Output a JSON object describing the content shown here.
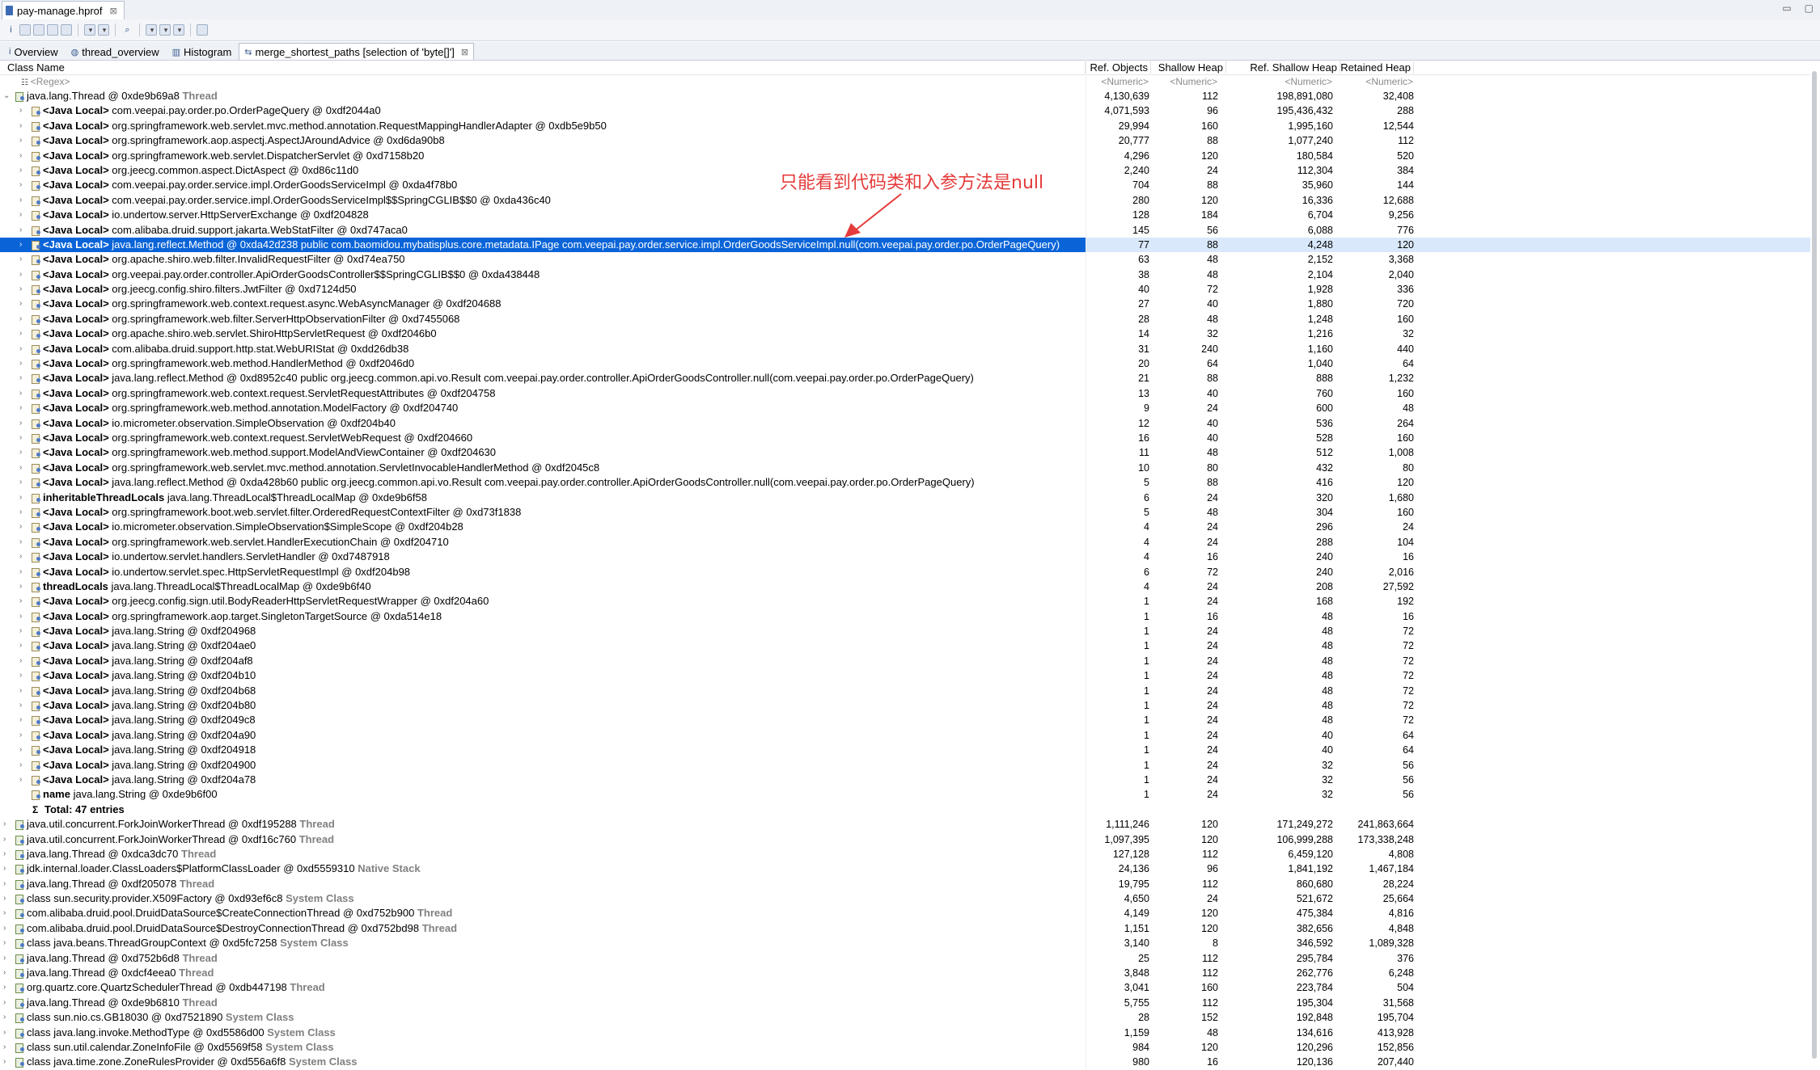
{
  "editor_tab": {
    "label": "pay-manage.hprof",
    "close": "⊠"
  },
  "view_tabs": [
    {
      "icon": "i",
      "label": "Overview"
    },
    {
      "icon": "◍",
      "label": "thread_overview"
    },
    {
      "icon": "▥",
      "label": "Histogram"
    },
    {
      "icon": "⇆",
      "label": "merge_shortest_paths [selection of 'byte[]']",
      "close": "⊠",
      "active": true
    }
  ],
  "columns": {
    "name": "Class Name",
    "ref_objects": "Ref. Objects",
    "shallow_heap": "Shallow Heap",
    "ref_shallow_heap": "Ref. Shallow Heap",
    "retained_heap": "Retained Heap"
  },
  "filters": {
    "name": "<Regex>",
    "numeric": "<Numeric>"
  },
  "annotation": "只能看到代码类和入参方法是null",
  "rows": [
    {
      "d": 0,
      "exp": "v",
      "icon": "thr",
      "t": "java.lang.Thread @ 0xde9b69a8",
      "tag": "Thread",
      "v": [
        "4,130,639",
        "112",
        "198,891,080",
        "32,408"
      ]
    },
    {
      "d": 1,
      "icon": "obj",
      "b": "<Java Local>",
      "t": "com.veepai.pay.order.po.OrderPageQuery @ 0xdf2044a0",
      "v": [
        "4,071,593",
        "96",
        "195,436,432",
        "288"
      ]
    },
    {
      "d": 1,
      "icon": "obj",
      "b": "<Java Local>",
      "t": "org.springframework.web.servlet.mvc.method.annotation.RequestMappingHandlerAdapter @ 0xdb5e9b50",
      "v": [
        "29,994",
        "160",
        "1,995,160",
        "12,544"
      ]
    },
    {
      "d": 1,
      "icon": "obj",
      "b": "<Java Local>",
      "t": "org.springframework.aop.aspectj.AspectJAroundAdvice @ 0xd6da90b8",
      "v": [
        "20,777",
        "88",
        "1,077,240",
        "112"
      ]
    },
    {
      "d": 1,
      "icon": "obj",
      "b": "<Java Local>",
      "t": "org.springframework.web.servlet.DispatcherServlet @ 0xd7158b20",
      "v": [
        "4,296",
        "120",
        "180,584",
        "520"
      ]
    },
    {
      "d": 1,
      "icon": "obj",
      "b": "<Java Local>",
      "t": "org.jeecg.common.aspect.DictAspect @ 0xd86c11d0",
      "v": [
        "2,240",
        "24",
        "112,304",
        "384"
      ]
    },
    {
      "d": 1,
      "icon": "obj",
      "b": "<Java Local>",
      "t": "com.veepai.pay.order.service.impl.OrderGoodsServiceImpl @ 0xda4f78b0",
      "v": [
        "704",
        "88",
        "35,960",
        "144"
      ]
    },
    {
      "d": 1,
      "icon": "obj",
      "b": "<Java Local>",
      "t": "com.veepai.pay.order.service.impl.OrderGoodsServiceImpl$$SpringCGLIB$$0 @ 0xda436c40",
      "v": [
        "280",
        "120",
        "16,336",
        "12,688"
      ]
    },
    {
      "d": 1,
      "icon": "obj",
      "b": "<Java Local>",
      "t": "io.undertow.server.HttpServerExchange @ 0xdf204828",
      "v": [
        "128",
        "184",
        "6,704",
        "9,256"
      ]
    },
    {
      "d": 1,
      "icon": "obj",
      "b": "<Java Local>",
      "t": "com.alibaba.druid.support.jakarta.WebStatFilter @ 0xd747aca0",
      "v": [
        "145",
        "56",
        "6,088",
        "776"
      ]
    },
    {
      "d": 1,
      "icon": "obj",
      "b": "<Java Local>",
      "t": "java.lang.reflect.Method @ 0xda42d238  public com.baomidou.mybatisplus.core.metadata.IPage com.veepai.pay.order.service.impl.OrderGoodsServiceImpl.null(com.veepai.pay.order.po.OrderPageQuery)",
      "v": [
        "77",
        "88",
        "4,248",
        "120"
      ],
      "sel": true
    },
    {
      "d": 1,
      "icon": "obj",
      "b": "<Java Local>",
      "t": "org.apache.shiro.web.filter.InvalidRequestFilter @ 0xd74ea750",
      "v": [
        "63",
        "48",
        "2,152",
        "3,368"
      ]
    },
    {
      "d": 1,
      "icon": "obj",
      "b": "<Java Local>",
      "t": "org.veepai.pay.order.controller.ApiOrderGoodsController$$SpringCGLIB$$0 @ 0xda438448",
      "v": [
        "38",
        "48",
        "2,104",
        "2,040"
      ]
    },
    {
      "d": 1,
      "icon": "obj",
      "b": "<Java Local>",
      "t": "org.jeecg.config.shiro.filters.JwtFilter @ 0xd7124d50",
      "v": [
        "40",
        "72",
        "1,928",
        "336"
      ]
    },
    {
      "d": 1,
      "icon": "obj",
      "b": "<Java Local>",
      "t": "org.springframework.web.context.request.async.WebAsyncManager @ 0xdf204688",
      "v": [
        "27",
        "40",
        "1,880",
        "720"
      ]
    },
    {
      "d": 1,
      "icon": "obj",
      "b": "<Java Local>",
      "t": "org.springframework.web.filter.ServerHttpObservationFilter @ 0xd7455068",
      "v": [
        "28",
        "48",
        "1,248",
        "160"
      ]
    },
    {
      "d": 1,
      "icon": "obj",
      "b": "<Java Local>",
      "t": "org.apache.shiro.web.servlet.ShiroHttpServletRequest @ 0xdf2046b0",
      "v": [
        "14",
        "32",
        "1,216",
        "32"
      ]
    },
    {
      "d": 1,
      "icon": "obj",
      "b": "<Java Local>",
      "t": "com.alibaba.druid.support.http.stat.WebURIStat @ 0xdd26db38",
      "v": [
        "31",
        "240",
        "1,160",
        "440"
      ]
    },
    {
      "d": 1,
      "icon": "obj",
      "b": "<Java Local>",
      "t": "org.springframework.web.method.HandlerMethod @ 0xdf2046d0",
      "v": [
        "20",
        "64",
        "1,040",
        "64"
      ]
    },
    {
      "d": 1,
      "icon": "obj",
      "b": "<Java Local>",
      "t": "java.lang.reflect.Method @ 0xd8952c40  public org.jeecg.common.api.vo.Result com.veepai.pay.order.controller.ApiOrderGoodsController.null(com.veepai.pay.order.po.OrderPageQuery)",
      "v": [
        "21",
        "88",
        "888",
        "1,232"
      ]
    },
    {
      "d": 1,
      "icon": "obj",
      "b": "<Java Local>",
      "t": "org.springframework.web.context.request.ServletRequestAttributes @ 0xdf204758",
      "v": [
        "13",
        "40",
        "760",
        "160"
      ]
    },
    {
      "d": 1,
      "icon": "obj",
      "b": "<Java Local>",
      "t": "org.springframework.web.method.annotation.ModelFactory @ 0xdf204740",
      "v": [
        "9",
        "24",
        "600",
        "48"
      ]
    },
    {
      "d": 1,
      "icon": "obj",
      "b": "<Java Local>",
      "t": "io.micrometer.observation.SimpleObservation @ 0xdf204b40",
      "v": [
        "12",
        "40",
        "536",
        "264"
      ]
    },
    {
      "d": 1,
      "icon": "obj",
      "b": "<Java Local>",
      "t": "org.springframework.web.context.request.ServletWebRequest @ 0xdf204660",
      "v": [
        "16",
        "40",
        "528",
        "160"
      ]
    },
    {
      "d": 1,
      "icon": "obj",
      "b": "<Java Local>",
      "t": "org.springframework.web.method.support.ModelAndViewContainer @ 0xdf204630",
      "v": [
        "11",
        "48",
        "512",
        "1,008"
      ]
    },
    {
      "d": 1,
      "icon": "obj",
      "b": "<Java Local>",
      "t": "org.springframework.web.servlet.mvc.method.annotation.ServletInvocableHandlerMethod @ 0xdf2045c8",
      "v": [
        "10",
        "80",
        "432",
        "80"
      ]
    },
    {
      "d": 1,
      "icon": "obj",
      "b": "<Java Local>",
      "t": "java.lang.reflect.Method @ 0xda428b60  public org.jeecg.common.api.vo.Result com.veepai.pay.order.controller.ApiOrderGoodsController.null(com.veepai.pay.order.po.OrderPageQuery)",
      "v": [
        "5",
        "88",
        "416",
        "120"
      ]
    },
    {
      "d": 1,
      "icon": "obj",
      "b": "inheritableThreadLocals",
      "t": "java.lang.ThreadLocal$ThreadLocalMap @ 0xde9b6f58",
      "v": [
        "6",
        "24",
        "320",
        "1,680"
      ]
    },
    {
      "d": 1,
      "icon": "obj",
      "b": "<Java Local>",
      "t": "org.springframework.boot.web.servlet.filter.OrderedRequestContextFilter @ 0xd73f1838",
      "v": [
        "5",
        "48",
        "304",
        "160"
      ]
    },
    {
      "d": 1,
      "icon": "obj",
      "b": "<Java Local>",
      "t": "io.micrometer.observation.SimpleObservation$SimpleScope @ 0xdf204b28",
      "v": [
        "4",
        "24",
        "296",
        "24"
      ]
    },
    {
      "d": 1,
      "icon": "obj",
      "b": "<Java Local>",
      "t": "org.springframework.web.servlet.HandlerExecutionChain @ 0xdf204710",
      "v": [
        "4",
        "24",
        "288",
        "104"
      ]
    },
    {
      "d": 1,
      "icon": "obj",
      "b": "<Java Local>",
      "t": "io.undertow.servlet.handlers.ServletHandler @ 0xd7487918",
      "v": [
        "4",
        "16",
        "240",
        "16"
      ]
    },
    {
      "d": 1,
      "icon": "obj",
      "b": "<Java Local>",
      "t": "io.undertow.servlet.spec.HttpServletRequestImpl @ 0xdf204b98",
      "v": [
        "6",
        "72",
        "240",
        "2,016"
      ]
    },
    {
      "d": 1,
      "icon": "obj",
      "b": "threadLocals",
      "t": "java.lang.ThreadLocal$ThreadLocalMap @ 0xde9b6f40",
      "v": [
        "4",
        "24",
        "208",
        "27,592"
      ]
    },
    {
      "d": 1,
      "icon": "obj",
      "b": "<Java Local>",
      "t": "org.jeecg.config.sign.util.BodyReaderHttpServletRequestWrapper @ 0xdf204a60",
      "v": [
        "1",
        "24",
        "168",
        "192"
      ]
    },
    {
      "d": 1,
      "icon": "obj",
      "b": "<Java Local>",
      "t": "org.springframework.aop.target.SingletonTargetSource @ 0xda514e18",
      "v": [
        "1",
        "16",
        "48",
        "16"
      ]
    },
    {
      "d": 1,
      "icon": "obj",
      "b": "<Java Local>",
      "t": "java.lang.String @ 0xdf204968",
      "v": [
        "1",
        "24",
        "48",
        "72"
      ]
    },
    {
      "d": 1,
      "icon": "obj",
      "b": "<Java Local>",
      "t": "java.lang.String @ 0xdf204ae0",
      "v": [
        "1",
        "24",
        "48",
        "72"
      ]
    },
    {
      "d": 1,
      "icon": "obj",
      "b": "<Java Local>",
      "t": "java.lang.String @ 0xdf204af8",
      "v": [
        "1",
        "24",
        "48",
        "72"
      ]
    },
    {
      "d": 1,
      "icon": "obj",
      "b": "<Java Local>",
      "t": "java.lang.String @ 0xdf204b10",
      "v": [
        "1",
        "24",
        "48",
        "72"
      ]
    },
    {
      "d": 1,
      "icon": "obj",
      "b": "<Java Local>",
      "t": "java.lang.String @ 0xdf204b68",
      "v": [
        "1",
        "24",
        "48",
        "72"
      ]
    },
    {
      "d": 1,
      "icon": "obj",
      "b": "<Java Local>",
      "t": "java.lang.String @ 0xdf204b80",
      "v": [
        "1",
        "24",
        "48",
        "72"
      ]
    },
    {
      "d": 1,
      "icon": "obj",
      "b": "<Java Local>",
      "t": "java.lang.String @ 0xdf2049c8",
      "v": [
        "1",
        "24",
        "48",
        "72"
      ]
    },
    {
      "d": 1,
      "icon": "obj",
      "b": "<Java Local>",
      "t": "java.lang.String @ 0xdf204a90",
      "v": [
        "1",
        "24",
        "40",
        "64"
      ]
    },
    {
      "d": 1,
      "icon": "obj",
      "b": "<Java Local>",
      "t": "java.lang.String @ 0xdf204918",
      "v": [
        "1",
        "24",
        "40",
        "64"
      ]
    },
    {
      "d": 1,
      "icon": "obj",
      "b": "<Java Local>",
      "t": "java.lang.String @ 0xdf204900",
      "v": [
        "1",
        "24",
        "32",
        "56"
      ]
    },
    {
      "d": 1,
      "icon": "obj",
      "b": "<Java Local>",
      "t": "java.lang.String @ 0xdf204a78",
      "v": [
        "1",
        "24",
        "32",
        "56"
      ]
    },
    {
      "d": 1,
      "icon": "obj",
      "noexp": true,
      "b": "name",
      "t": "java.lang.String @ 0xde9b6f00",
      "v": [
        "1",
        "24",
        "32",
        "56"
      ]
    },
    {
      "d": 1,
      "sum": true,
      "b": "Total: 47 entries",
      "t": "",
      "v": [
        "",
        "",
        "",
        ""
      ]
    },
    {
      "d": 0,
      "icon": "thr",
      "t": "java.util.concurrent.ForkJoinWorkerThread @ 0xdf195288",
      "tag": "Thread",
      "v": [
        "1,111,246",
        "120",
        "171,249,272",
        "241,863,664"
      ]
    },
    {
      "d": 0,
      "icon": "thr",
      "t": "java.util.concurrent.ForkJoinWorkerThread @ 0xdf16c760",
      "tag": "Thread",
      "v": [
        "1,097,395",
        "120",
        "106,999,288",
        "173,338,248"
      ]
    },
    {
      "d": 0,
      "icon": "thr",
      "t": "java.lang.Thread @ 0xdca3dc70",
      "tag": "Thread",
      "v": [
        "127,128",
        "112",
        "6,459,120",
        "4,808"
      ]
    },
    {
      "d": 0,
      "icon": "thr",
      "t": "jdk.internal.loader.ClassLoaders$PlatformClassLoader @ 0xd5559310",
      "tag": "Native Stack",
      "v": [
        "24,136",
        "96",
        "1,841,192",
        "1,467,184"
      ]
    },
    {
      "d": 0,
      "icon": "thr",
      "t": "java.lang.Thread @ 0xdf205078",
      "tag": "Thread",
      "v": [
        "19,795",
        "112",
        "860,680",
        "28,224"
      ]
    },
    {
      "d": 0,
      "icon": "thr",
      "t": "class sun.security.provider.X509Factory @ 0xd93ef6c8",
      "tag": "System Class",
      "v": [
        "4,650",
        "24",
        "521,672",
        "25,664"
      ]
    },
    {
      "d": 0,
      "icon": "thr",
      "t": "com.alibaba.druid.pool.DruidDataSource$CreateConnectionThread @ 0xd752b900",
      "tag": "Thread",
      "v": [
        "4,149",
        "120",
        "475,384",
        "4,816"
      ]
    },
    {
      "d": 0,
      "icon": "thr",
      "t": "com.alibaba.druid.pool.DruidDataSource$DestroyConnectionThread @ 0xd752bd98",
      "tag": "Thread",
      "v": [
        "1,151",
        "120",
        "382,656",
        "4,848"
      ]
    },
    {
      "d": 0,
      "icon": "thr",
      "t": "class java.beans.ThreadGroupContext @ 0xd5fc7258",
      "tag": "System Class",
      "v": [
        "3,140",
        "8",
        "346,592",
        "1,089,328"
      ]
    },
    {
      "d": 0,
      "icon": "thr",
      "t": "java.lang.Thread @ 0xd752b6d8",
      "tag": "Thread",
      "v": [
        "25",
        "112",
        "295,784",
        "376"
      ]
    },
    {
      "d": 0,
      "icon": "thr",
      "t": "java.lang.Thread @ 0xdcf4eea0",
      "tag": "Thread",
      "v": [
        "3,848",
        "112",
        "262,776",
        "6,248"
      ]
    },
    {
      "d": 0,
      "icon": "thr",
      "t": "org.quartz.core.QuartzSchedulerThread @ 0xdb447198",
      "tag": "Thread",
      "v": [
        "3,041",
        "160",
        "223,784",
        "504"
      ]
    },
    {
      "d": 0,
      "icon": "thr",
      "t": "java.lang.Thread @ 0xde9b6810",
      "tag": "Thread",
      "v": [
        "5,755",
        "112",
        "195,304",
        "31,568"
      ]
    },
    {
      "d": 0,
      "icon": "thr",
      "t": "class sun.nio.cs.GB18030 @ 0xd7521890",
      "tag": "System Class",
      "v": [
        "28",
        "152",
        "192,848",
        "195,704"
      ]
    },
    {
      "d": 0,
      "icon": "thr",
      "t": "class java.lang.invoke.MethodType @ 0xd5586d00",
      "tag": "System Class",
      "v": [
        "1,159",
        "48",
        "134,616",
        "413,928"
      ]
    },
    {
      "d": 0,
      "icon": "thr",
      "t": "class sun.util.calendar.ZoneInfoFile @ 0xd5569f58",
      "tag": "System Class",
      "v": [
        "984",
        "120",
        "120,296",
        "152,856"
      ]
    },
    {
      "d": 0,
      "icon": "thr",
      "t": "class java.time.zone.ZoneRulesProvider @ 0xd556a6f8",
      "tag": "System Class",
      "v": [
        "980",
        "16",
        "120,136",
        "207,440"
      ]
    }
  ]
}
